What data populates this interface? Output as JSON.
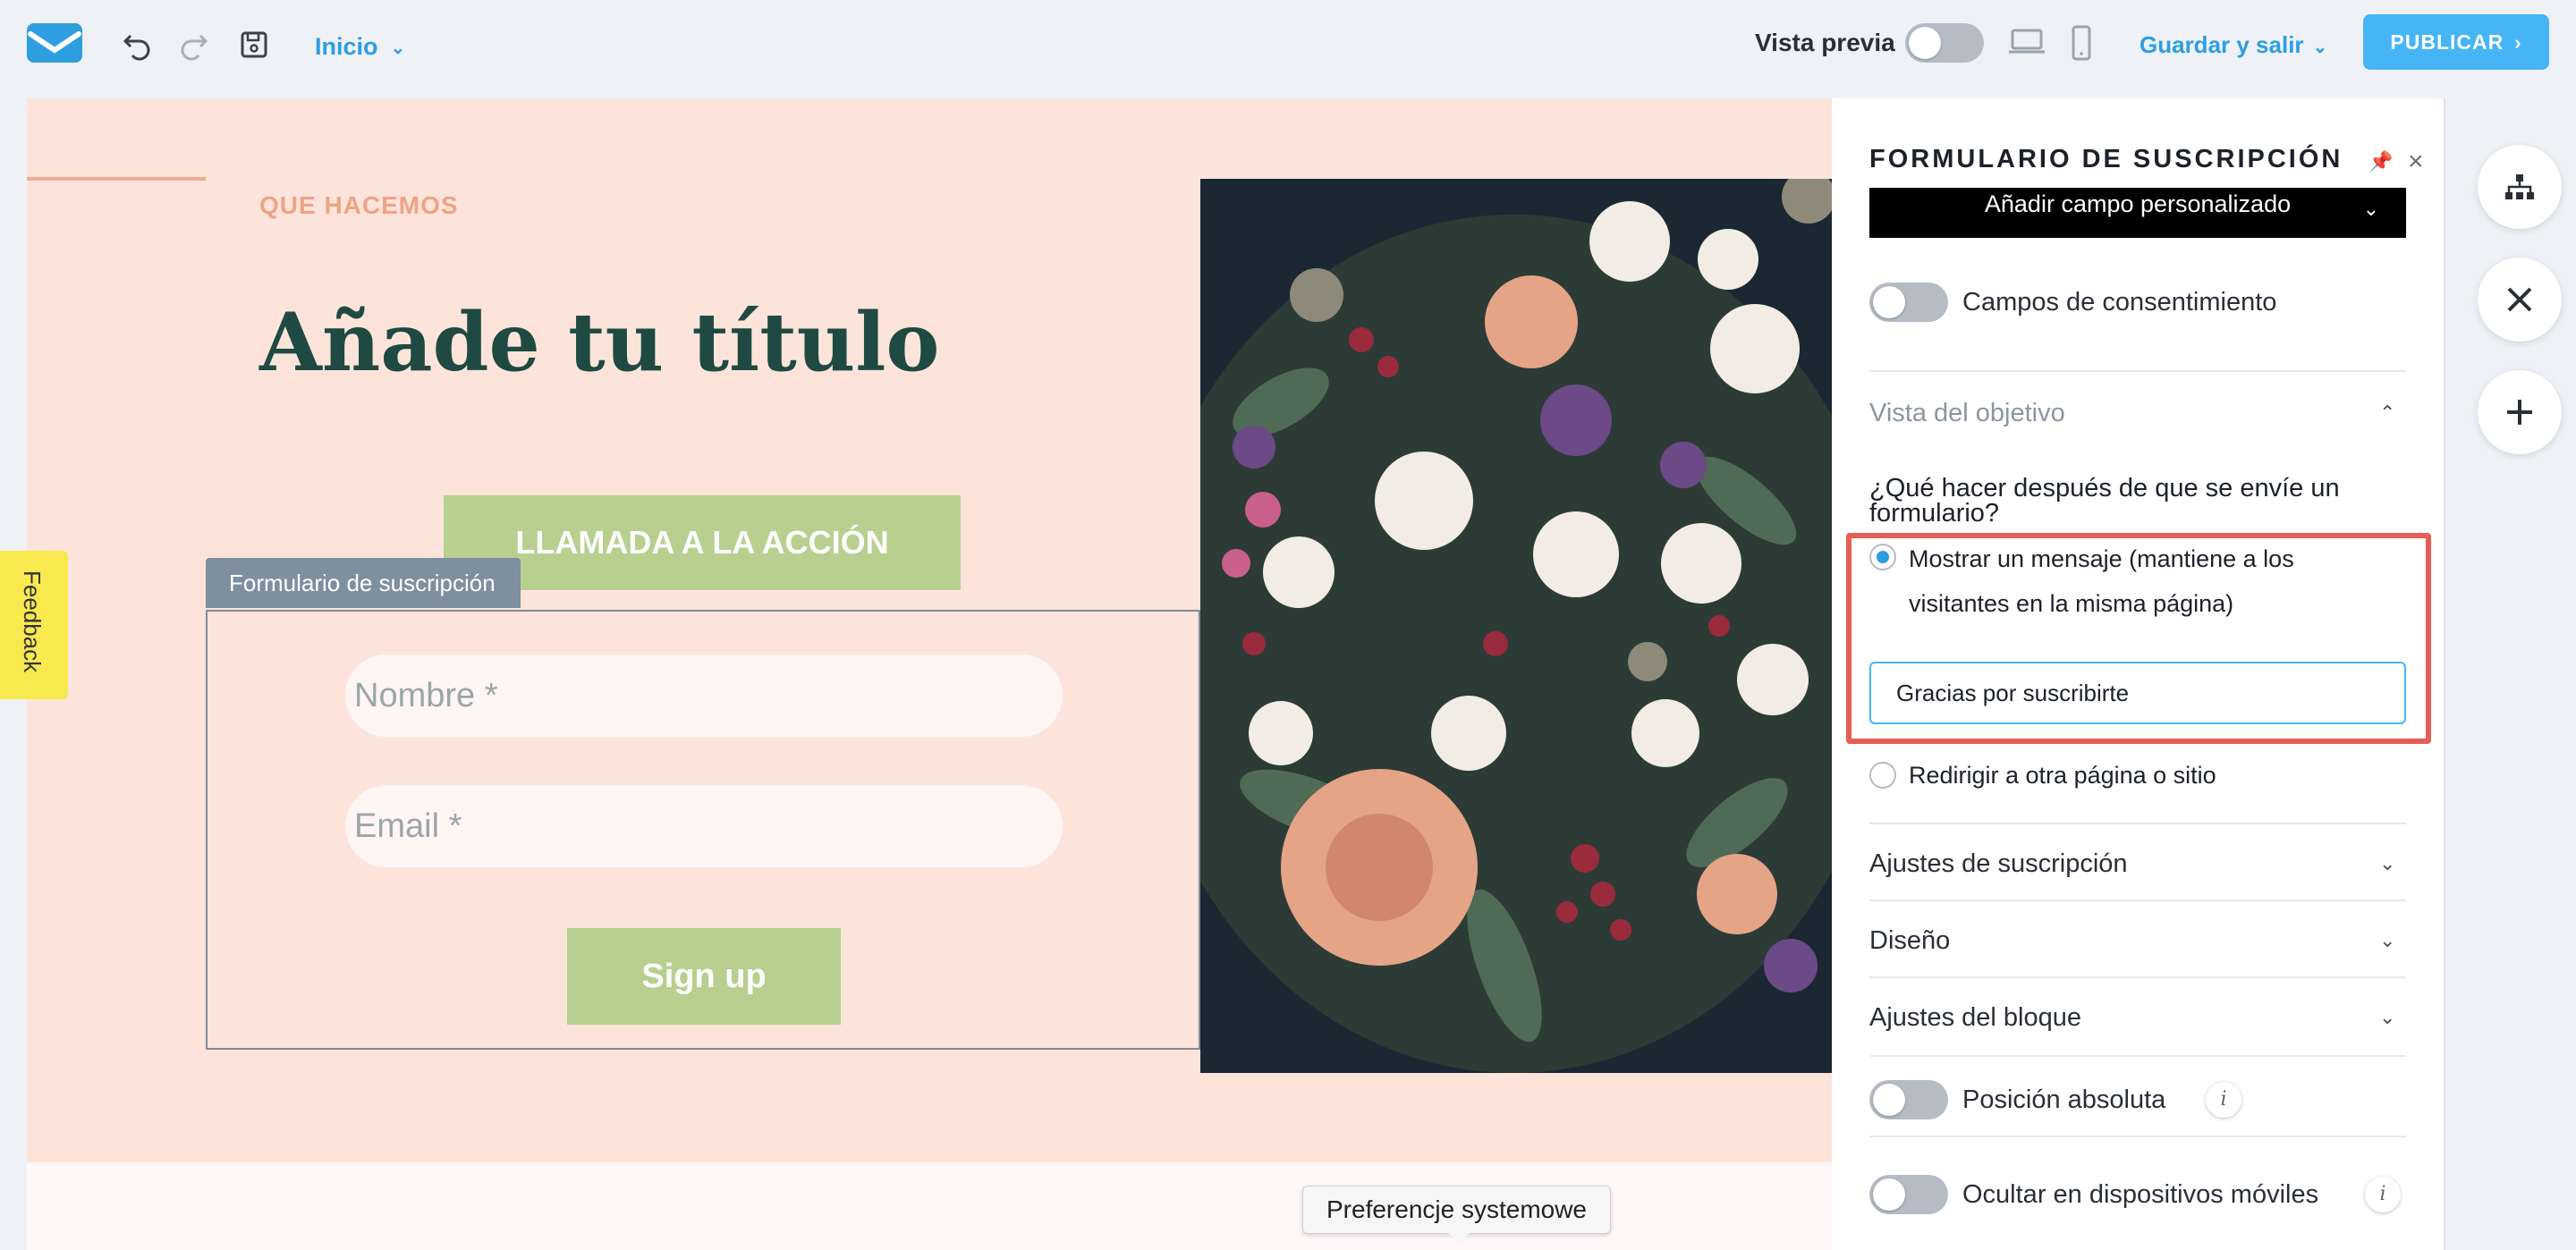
{
  "topbar": {
    "page_selector": "Inicio",
    "preview_label": "Vista previa",
    "save_exit": "Guardar y salir",
    "publish": "PUBLICAR"
  },
  "canvas": {
    "eyebrow": "QUE HACEMOS",
    "title": "Añade tu título",
    "cta": "LLAMADA A LA ACCIÓN",
    "form_tab": "Formulario de suscripción",
    "name_placeholder": "Nombre *",
    "email_placeholder": "Email *",
    "signup": "Sign up",
    "tooltip": "Preferencje systemowe"
  },
  "feedback": "Feedback",
  "panel": {
    "title": "FORMULARIO DE SUSCRIPCIÓN",
    "add_field": "Añadir campo personalizado",
    "consent": "Campos de consentimiento",
    "goal_view": "Vista del objetivo",
    "question": "¿Qué hacer después de que se envíe un formulario?",
    "option_message_line1": "Mostrar un mensaje (mantiene a los",
    "option_message_line2": "visitantes en la misma página)",
    "message_value": "Gracias por suscribirte",
    "option_redirect": "Redirigir a otra página o sitio",
    "subscription_settings": "Ajustes de suscripción",
    "design": "Diseño",
    "block_settings": "Ajustes del bloque",
    "absolute_position": "Posición absoluta",
    "hide_mobile": "Ocultar en dispositivos móviles"
  },
  "colors": {
    "accent": "#2d9ee0",
    "publish": "#45b5f5",
    "hero_bg": "#fde4db",
    "button_green": "#b7cf8f",
    "highlight_red": "#e65e53"
  }
}
